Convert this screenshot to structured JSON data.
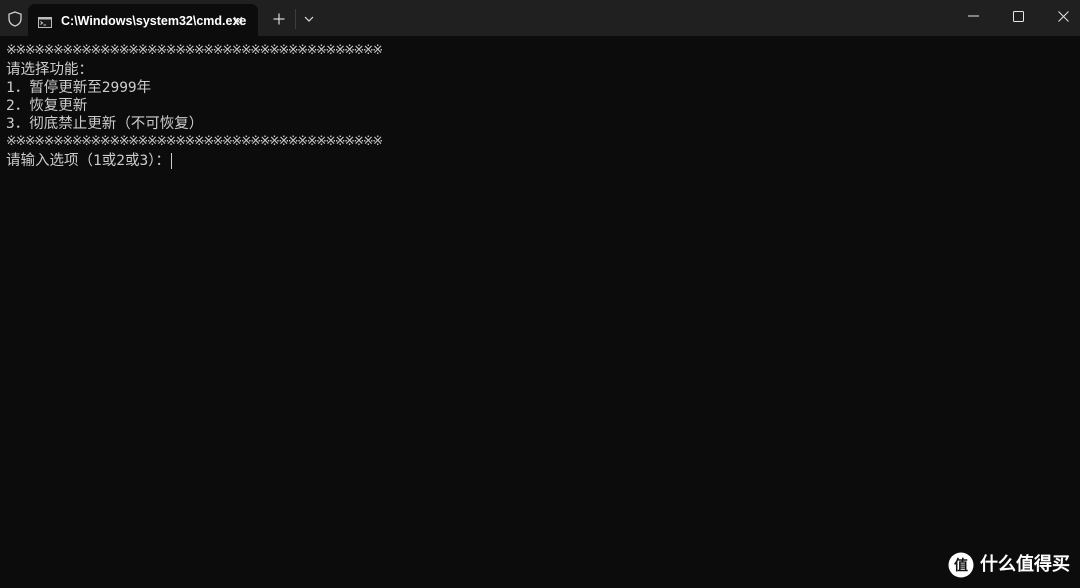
{
  "window": {
    "tab_title": "C:\\Windows\\system32\\cmd.exe",
    "icons": {
      "shield": "shield-icon",
      "tab_icon": "cmd-icon",
      "tab_close": "close-icon",
      "new_tab": "plus-icon",
      "dropdown": "chevron-down-icon",
      "minimize": "minimize-icon",
      "maximize": "maximize-icon",
      "close": "close-icon"
    }
  },
  "console": {
    "separator_top": "※※※※※※※※※※※※※※※※※※※※※※※※※※※※※※※※※※※※※※※※",
    "prompt_title": "请选择功能：",
    "options": [
      "1．暂停更新至2999年",
      "2．恢复更新",
      "3．彻底禁止更新（不可恢复）"
    ],
    "separator_bottom": "※※※※※※※※※※※※※※※※※※※※※※※※※※※※※※※※※※※※※※※※",
    "input_prompt": "请输入选项（1或2或3）："
  },
  "watermark": {
    "text": "什么值得买",
    "logo": "smzdm-logo"
  },
  "colors": {
    "console_bg": "#0c0c0c",
    "titlebar_bg": "#202020",
    "text": "#cccccc",
    "title_text": "#ffffff"
  }
}
